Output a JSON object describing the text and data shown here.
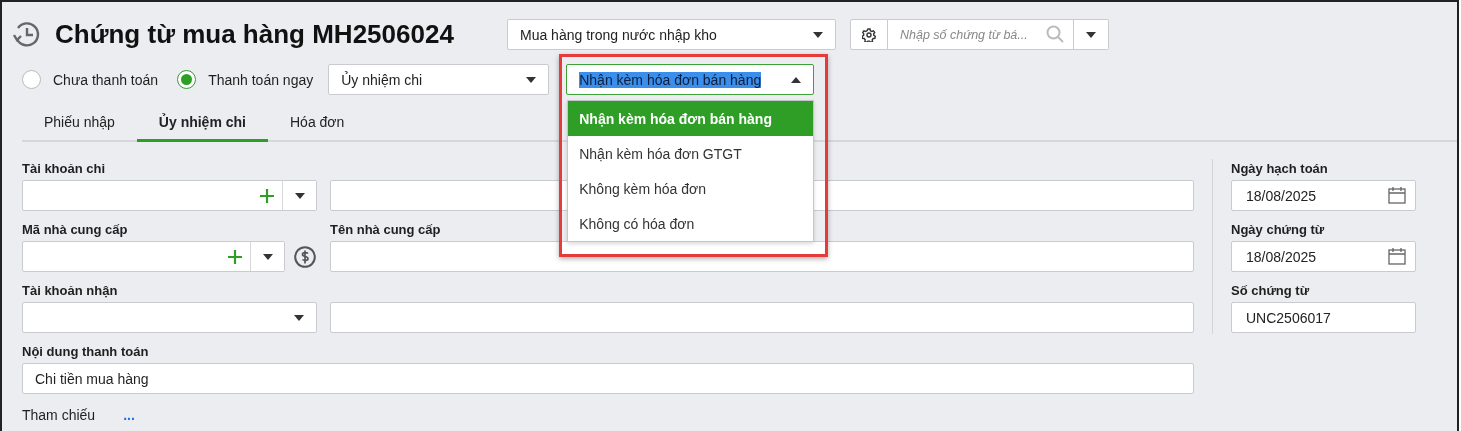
{
  "header": {
    "title": "Chứng từ mua hàng MH2506024",
    "voucher_type": {
      "value": "Mua hàng trong nước nhập kho"
    },
    "search": {
      "placeholder": "Nhập số chứng từ bá..."
    }
  },
  "payment_options": [
    {
      "label": "Chưa thanh toán",
      "selected": false
    },
    {
      "label": "Thanh toán ngay",
      "selected": true
    }
  ],
  "payment_method": {
    "value": "Ủy nhiệm chi"
  },
  "invoice_select": {
    "value": "Nhận kèm hóa đơn bán hàng",
    "expanded": true,
    "options": [
      {
        "label": "Nhận kèm hóa đơn bán hàng",
        "selected": true
      },
      {
        "label": "Nhận kèm hóa đơn GTGT",
        "selected": false
      },
      {
        "label": "Không kèm hóa đơn",
        "selected": false
      },
      {
        "label": "Không có hóa đơn",
        "selected": false
      }
    ]
  },
  "tabs": [
    {
      "label": "Phiếu nhập",
      "selected": false
    },
    {
      "label": "Ủy nhiệm chi",
      "selected": true
    },
    {
      "label": "Hóa đơn",
      "selected": false
    }
  ],
  "form": {
    "paying_account": {
      "label": "Tài khoản chi"
    },
    "supplier_code": {
      "label": "Mã nhà cung cấp"
    },
    "supplier_name": {
      "label": "Tên nhà cung cấp"
    },
    "receiving_account": {
      "label": "Tài khoản nhận"
    },
    "payment_content": {
      "label": "Nội dung thanh toán",
      "value": "Chi tiền mua hàng"
    },
    "reference": {
      "label": "Tham chiếu",
      "link": "..."
    }
  },
  "side_fields": [
    {
      "label": "Ngày hạch toán",
      "value": "18/08/2025",
      "kind": "date"
    },
    {
      "label": "Ngày chứng từ",
      "value": "18/08/2025",
      "kind": "date"
    },
    {
      "label": "Số chứng từ",
      "value": "UNC2506017",
      "kind": "text"
    }
  ]
}
